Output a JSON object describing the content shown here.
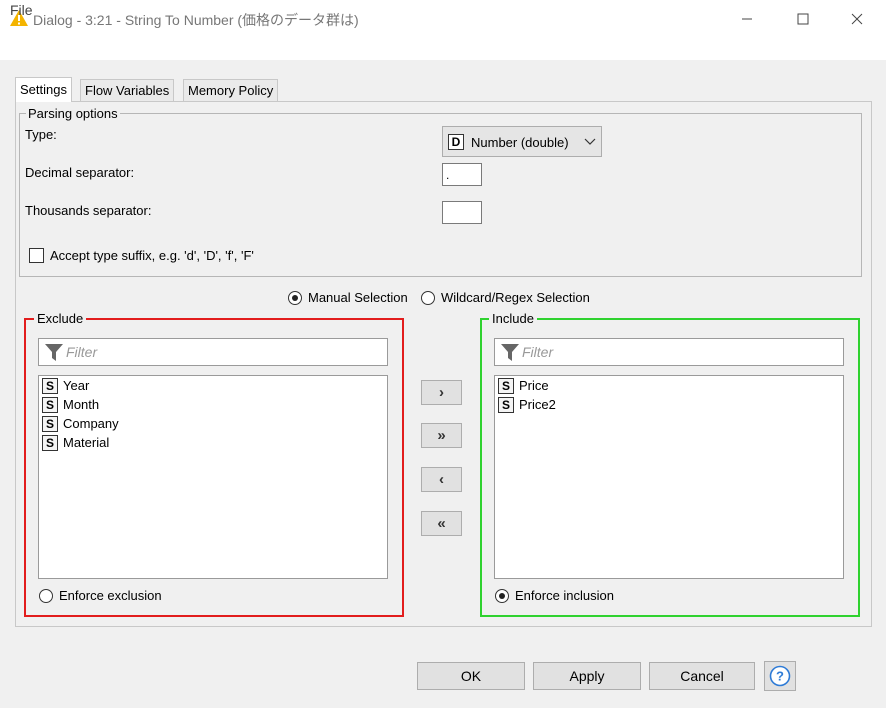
{
  "window": {
    "title": "Dialog - 3:21 - String To Number (価格のデータ群は)",
    "accent_color": "#f4b400"
  },
  "menu": {
    "file": "File"
  },
  "tabs": [
    {
      "label": "Settings",
      "active": true
    },
    {
      "label": "Flow Variables",
      "active": false
    },
    {
      "label": "Memory Policy",
      "active": false
    }
  ],
  "parsing": {
    "legend": "Parsing options",
    "type_label": "Type:",
    "type_icon_letter": "D",
    "type_value": "Number (double)",
    "decimal_label": "Decimal separator:",
    "decimal_value": ".",
    "thousands_label": "Thousands separator:",
    "thousands_value": "",
    "suffix_label": "Accept type suffix, e.g. 'd', 'D', 'f', 'F'",
    "suffix_checked": false
  },
  "selection_mode": {
    "manual_label": "Manual Selection",
    "wildcard_label": "Wildcard/Regex Selection",
    "selected": "manual"
  },
  "exclude": {
    "legend": "Exclude",
    "border_color": "#e21d1d",
    "filter_placeholder": "Filter",
    "items": [
      {
        "type": "S",
        "name": "Year"
      },
      {
        "type": "S",
        "name": "Month"
      },
      {
        "type": "S",
        "name": "Company"
      },
      {
        "type": "S",
        "name": "Material"
      }
    ],
    "enforce_label": "Enforce exclusion",
    "enforce_selected": false
  },
  "include": {
    "legend": "Include",
    "border_color": "#2fd22f",
    "filter_placeholder": "Filter",
    "items": [
      {
        "type": "S",
        "name": "Price"
      },
      {
        "type": "S",
        "name": "Price2"
      }
    ],
    "enforce_label": "Enforce inclusion",
    "enforce_selected": true
  },
  "move_buttons": {
    "add": "›",
    "add_all": "»",
    "remove": "‹",
    "remove_all": "«"
  },
  "footer": {
    "ok": "OK",
    "apply": "Apply",
    "cancel": "Cancel",
    "help": "?"
  }
}
